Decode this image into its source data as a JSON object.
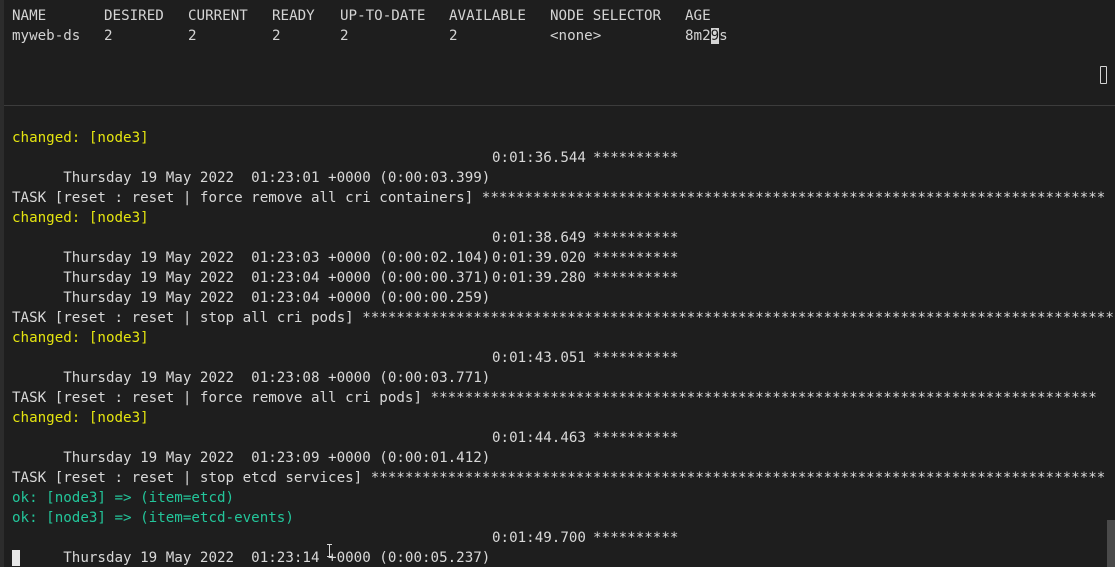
{
  "colors": {
    "background": "#1e1e1e",
    "text": "#d4d4d4",
    "changed": "#e5e510",
    "ok": "#23c59a"
  },
  "top_pane": {
    "headers": [
      "NAME",
      "DESIRED",
      "CURRENT",
      "READY",
      "UP-TO-DATE",
      "AVAILABLE",
      "NODE SELECTOR",
      "AGE"
    ],
    "row": {
      "name": "myweb-ds",
      "desired": "2",
      "current": "2",
      "ready": "2",
      "up_to_date": "2",
      "available": "2",
      "node_selector": "<none>",
      "age_before": "8m2",
      "age_caret": "9",
      "age_after": "s"
    },
    "scroll_indicator_icon": "scroll-indicator-icon"
  },
  "log": {
    "l1": "changed: [node3]",
    "l2": {
      "ts": "Thursday 19 May 2022  01:23:01 +0000 (0:00:03.399)",
      "elapsed": "0:01:36.544",
      "stars": "**********"
    },
    "l3": "TASK [reset : reset | force remove all cri containers] *************************************************************************",
    "l4": "changed: [node3]",
    "l5": {
      "ts": "Thursday 19 May 2022  01:23:03 +0000 (0:00:02.104)",
      "elapsed": "0:01:38.649",
      "stars": "**********"
    },
    "l6": {
      "ts": "Thursday 19 May 2022  01:23:04 +0000 (0:00:00.371)",
      "elapsed": "0:01:39.020",
      "stars": "**********"
    },
    "l7": {
      "ts": "Thursday 19 May 2022  01:23:04 +0000 (0:00:00.259)",
      "elapsed": "0:01:39.280",
      "stars": "**********"
    },
    "l8": "TASK [reset : reset | stop all cri pods] *****************************************************************************************",
    "l9": "changed: [node3]",
    "l10": {
      "ts": "Thursday 19 May 2022  01:23:08 +0000 (0:00:03.771)",
      "elapsed": "0:01:43.051",
      "stars": "**********"
    },
    "l11": "TASK [reset : reset | force remove all cri pods] ******************************************************************************",
    "l12": "changed: [node3]",
    "l13": {
      "ts": "Thursday 19 May 2022  01:23:09 +0000 (0:00:01.412)",
      "elapsed": "0:01:44.463",
      "stars": "**********"
    },
    "l14": "TASK [reset : reset | stop etcd services] **************************************************************************************",
    "l15": "ok: [node3] => (item=etcd)",
    "l16": "ok: [node3] => (item=etcd-events)",
    "l17": {
      "ts": "Thursday 19 May 2022  01:23:14 +0000 (0:00:05.237)",
      "elapsed": "0:01:49.700",
      "stars": "**********"
    }
  }
}
